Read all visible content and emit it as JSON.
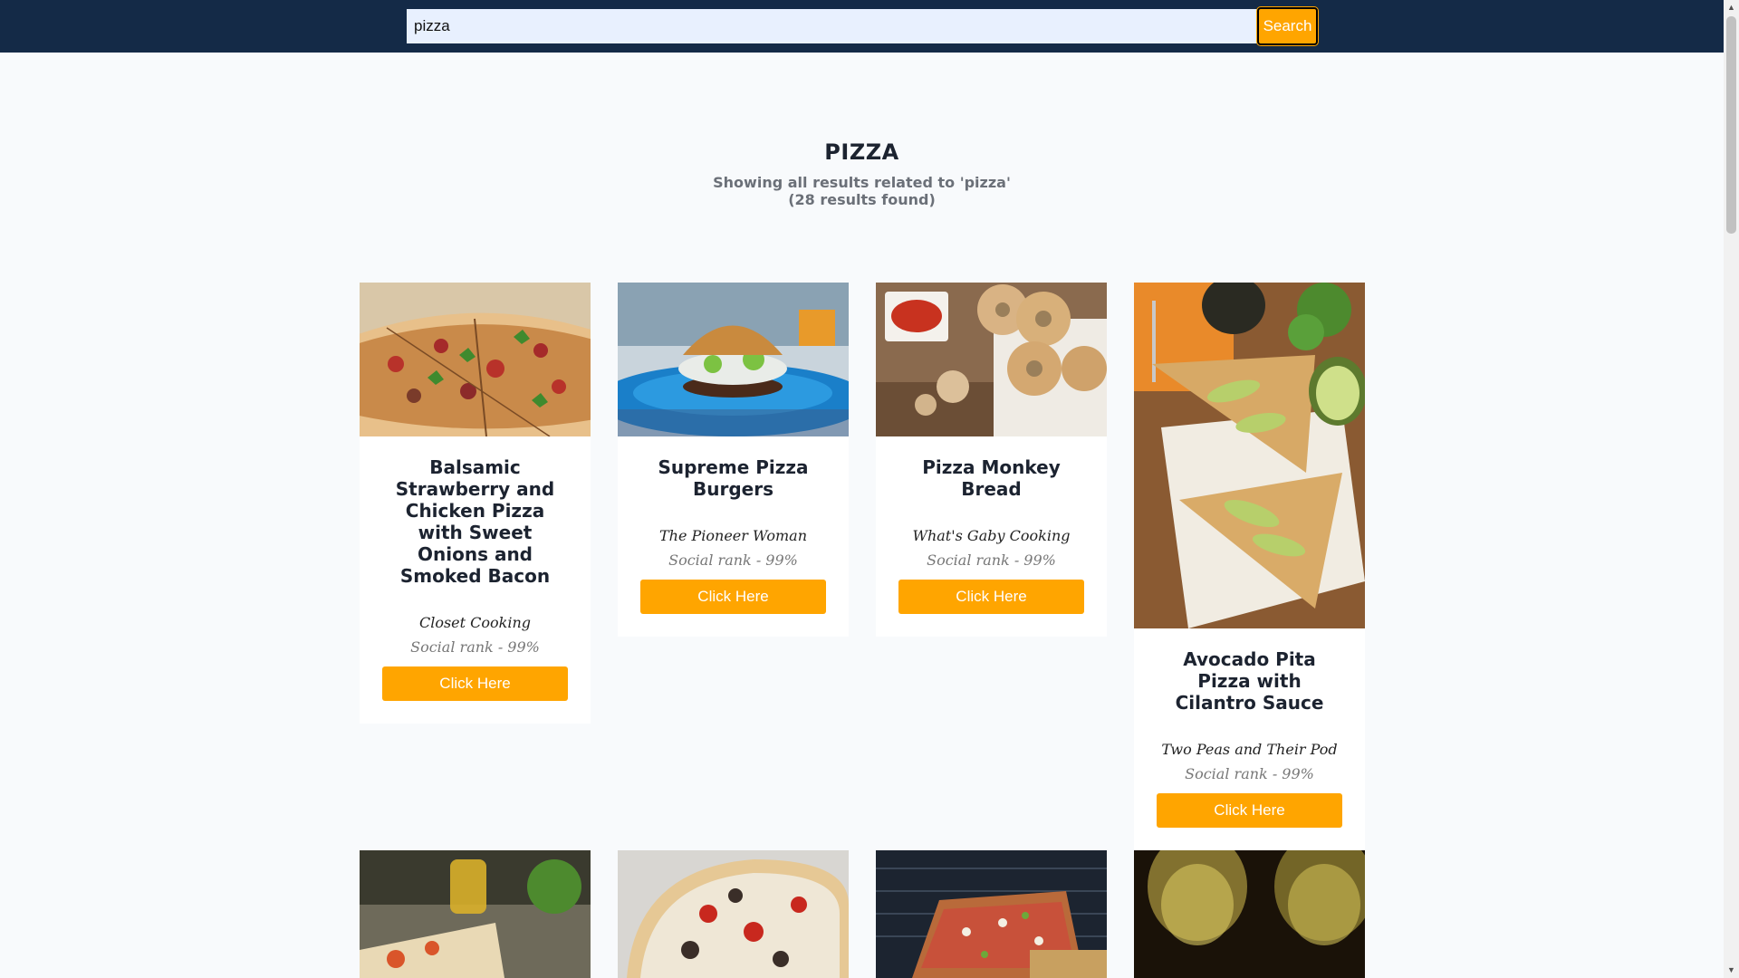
{
  "search": {
    "value": "pizza",
    "button_label": "Search"
  },
  "header": {
    "title": "PIZZA",
    "subtitle_line1": "Showing all results related to 'pizza'",
    "subtitle_line2": "(28 results found)"
  },
  "recipes": [
    {
      "title": "Balsamic Strawberry and Chicken Pizza with Sweet Onions and Smoked Bacon",
      "publisher": "Closet Cooking",
      "rank": "Social rank - 99%",
      "button_label": "Click Here"
    },
    {
      "title": "Supreme Pizza Burgers",
      "publisher": "The Pioneer Woman",
      "rank": "Social rank - 99%",
      "button_label": "Click Here"
    },
    {
      "title": "Pizza Monkey Bread",
      "publisher": "What's Gaby Cooking",
      "rank": "Social rank - 99%",
      "button_label": "Click Here"
    },
    {
      "title": "Avocado Pita Pizza with Cilantro Sauce",
      "publisher": "Two Peas and Their Pod",
      "rank": "Social rank - 99%",
      "button_label": "Click Here"
    }
  ],
  "colors": {
    "topbar": "#142a47",
    "accent": "#ffa500",
    "background": "#f8fafc"
  }
}
